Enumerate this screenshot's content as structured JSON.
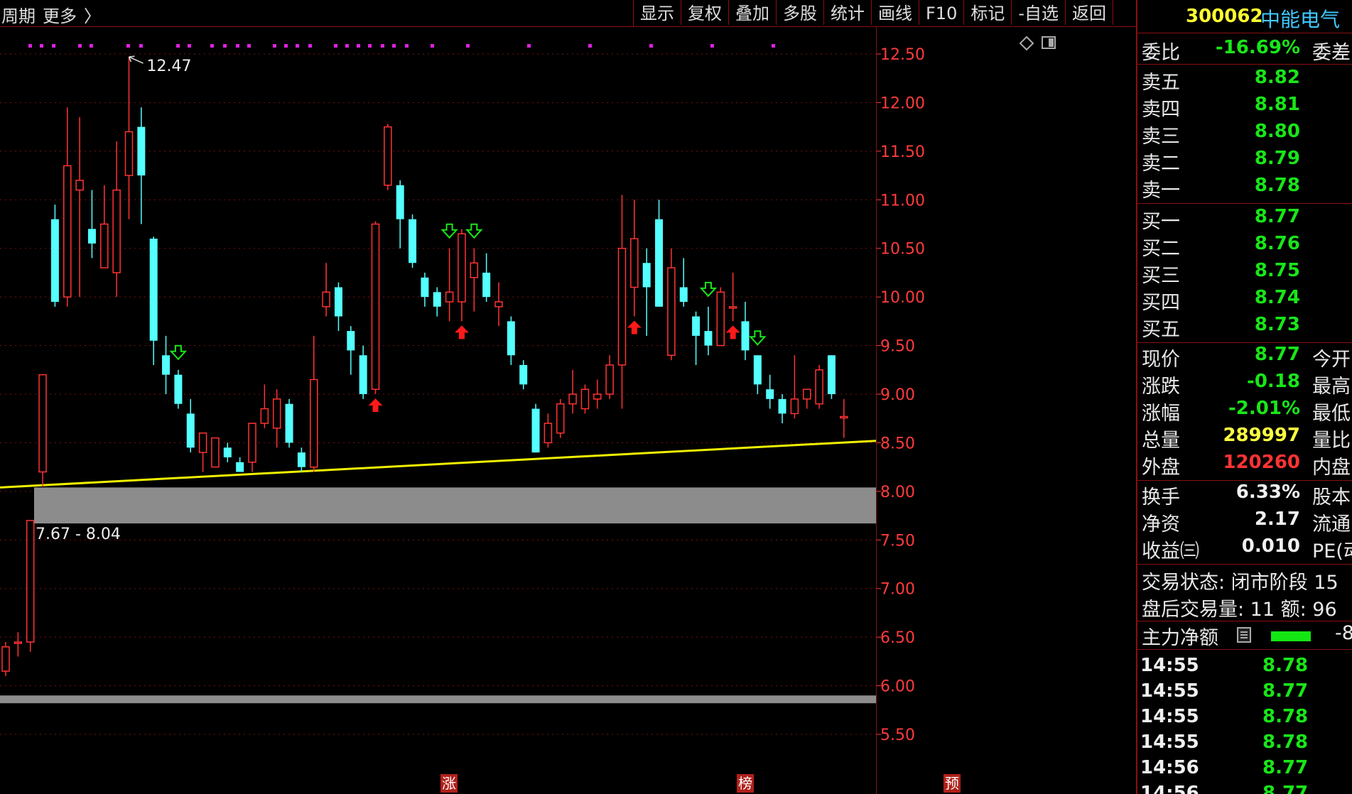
{
  "toolbar": {
    "period_label": "周期",
    "more_label": "更多",
    "more_arrow": "〉",
    "menu": [
      "显示",
      "复权",
      "叠加",
      "多股",
      "统计",
      "画线",
      "F10",
      "标记",
      "-自选",
      "返回"
    ]
  },
  "stock": {
    "code": "300062",
    "name": "中能电气"
  },
  "quote": {
    "weibi_label": "委比",
    "weibi_value": "-16.69%",
    "weicha_label": "委差",
    "asks": [
      {
        "label": "卖五",
        "price": "8.82"
      },
      {
        "label": "卖四",
        "price": "8.81"
      },
      {
        "label": "卖三",
        "price": "8.80"
      },
      {
        "label": "卖二",
        "price": "8.79"
      },
      {
        "label": "卖一",
        "price": "8.78"
      }
    ],
    "bids": [
      {
        "label": "买一",
        "price": "8.77"
      },
      {
        "label": "买二",
        "price": "8.76"
      },
      {
        "label": "买三",
        "price": "8.75"
      },
      {
        "label": "买四",
        "price": "8.74"
      },
      {
        "label": "买五",
        "price": "8.73"
      }
    ],
    "stats": [
      {
        "label": "现价",
        "value": "8.77",
        "label2": "今开",
        "color": "green"
      },
      {
        "label": "涨跌",
        "value": "-0.18",
        "label2": "最高",
        "color": "green"
      },
      {
        "label": "涨幅",
        "value": "-2.01%",
        "label2": "最低",
        "color": "green"
      },
      {
        "label": "总量",
        "value": "289997",
        "label2": "量比",
        "color": "yellow"
      },
      {
        "label": "外盘",
        "value": "120260",
        "label2": "内盘",
        "color": "red"
      }
    ],
    "stats2": [
      {
        "label": "换手",
        "value": "6.33%",
        "label2": "股本"
      },
      {
        "label": "净资",
        "value": "2.17",
        "label2": "流通"
      },
      {
        "label": "收益㈢",
        "value": "0.010",
        "label2": "PE(动"
      }
    ],
    "trade_status": "交易状态: 闭市阶段 15",
    "after_hours": "盘后交易量: 11  额: 96",
    "net_label": "主力净额",
    "net_value": "-8",
    "ticks": [
      {
        "time": "14:55",
        "price": "8.78"
      },
      {
        "time": "14:55",
        "price": "8.77"
      },
      {
        "time": "14:55",
        "price": "8.78"
      },
      {
        "time": "14:55",
        "price": "8.78"
      },
      {
        "time": "14:56",
        "price": "8.77"
      },
      {
        "time": "14:56",
        "price": "8.77"
      }
    ]
  },
  "colors": {
    "up": "#ff3333",
    "down": "#54ffff",
    "grid": "#7a1010",
    "axis_text": "#ff3b3b",
    "trendline": "#f0f000",
    "zone": "#8c8c8c",
    "dot": "#e020e0"
  },
  "chart_data": {
    "type": "candlestick",
    "y_ticks": [
      "12.50",
      "12.00",
      "11.50",
      "11.00",
      "10.50",
      "10.00",
      "9.50",
      "9.00",
      "8.50",
      "8.00",
      "7.50",
      "7.00",
      "6.50",
      "6.00",
      "5.50"
    ],
    "ylim": [
      5.5,
      12.5
    ],
    "grid": true,
    "candles": [
      {
        "o": 6.15,
        "c": 6.4,
        "h": 6.45,
        "l": 6.1
      },
      {
        "o": 6.45,
        "c": 6.45,
        "h": 6.55,
        "l": 6.3
      },
      {
        "o": 6.45,
        "c": 7.7,
        "h": 7.7,
        "l": 6.35
      },
      {
        "o": 8.2,
        "c": 9.2,
        "h": 9.2,
        "l": 8.05
      },
      {
        "o": 10.8,
        "c": 9.95,
        "h": 10.95,
        "l": 9.9
      },
      {
        "o": 10.0,
        "c": 11.35,
        "h": 11.95,
        "l": 9.9
      },
      {
        "o": 11.1,
        "c": 11.2,
        "h": 11.85,
        "l": 10.0
      },
      {
        "o": 10.7,
        "c": 10.55,
        "h": 11.1,
        "l": 10.4
      },
      {
        "o": 10.3,
        "c": 10.75,
        "h": 11.15,
        "l": 10.5
      },
      {
        "o": 10.25,
        "c": 11.1,
        "h": 11.6,
        "l": 10.0
      },
      {
        "o": 11.25,
        "c": 11.7,
        "h": 12.47,
        "l": 10.8
      },
      {
        "o": 11.75,
        "c": 11.25,
        "h": 11.95,
        "l": 10.75
      },
      {
        "o": 10.6,
        "c": 9.55,
        "h": 10.62,
        "l": 9.3
      },
      {
        "o": 9.4,
        "c": 9.2,
        "h": 9.6,
        "l": 9.0
      },
      {
        "o": 9.2,
        "c": 8.9,
        "h": 9.25,
        "l": 8.85
      },
      {
        "o": 8.8,
        "c": 8.45,
        "h": 8.95,
        "l": 8.4
      },
      {
        "o": 8.4,
        "c": 8.6,
        "h": 8.6,
        "l": 8.2
      },
      {
        "o": 8.25,
        "c": 8.55,
        "h": 8.55,
        "l": 8.25
      },
      {
        "o": 8.45,
        "c": 8.35,
        "h": 8.5,
        "l": 8.3
      },
      {
        "o": 8.3,
        "c": 8.2,
        "h": 8.35,
        "l": 8.2
      },
      {
        "o": 8.3,
        "c": 8.7,
        "h": 8.7,
        "l": 8.2
      },
      {
        "o": 8.7,
        "c": 8.85,
        "h": 9.1,
        "l": 8.65
      },
      {
        "o": 8.65,
        "c": 8.95,
        "h": 9.05,
        "l": 8.45
      },
      {
        "o": 8.9,
        "c": 8.5,
        "h": 8.95,
        "l": 8.45
      },
      {
        "o": 8.4,
        "c": 8.25,
        "h": 8.45,
        "l": 8.2
      },
      {
        "o": 8.25,
        "c": 9.15,
        "h": 9.6,
        "l": 8.2
      },
      {
        "o": 9.9,
        "c": 10.05,
        "h": 10.35,
        "l": 9.8
      },
      {
        "o": 10.1,
        "c": 9.8,
        "h": 10.15,
        "l": 9.65
      },
      {
        "o": 9.65,
        "c": 9.45,
        "h": 9.7,
        "l": 9.2
      },
      {
        "o": 9.4,
        "c": 9.0,
        "h": 9.5,
        "l": 8.95
      },
      {
        "o": 9.05,
        "c": 10.75,
        "h": 10.78,
        "l": 9.0
      },
      {
        "o": 11.15,
        "c": 11.75,
        "h": 11.78,
        "l": 11.1
      },
      {
        "o": 11.15,
        "c": 10.8,
        "h": 11.2,
        "l": 10.5
      },
      {
        "o": 10.8,
        "c": 10.35,
        "h": 10.85,
        "l": 10.3
      },
      {
        "o": 10.2,
        "c": 10.0,
        "h": 10.25,
        "l": 9.9
      },
      {
        "o": 10.05,
        "c": 9.9,
        "h": 10.1,
        "l": 9.8
      },
      {
        "o": 9.95,
        "c": 10.05,
        "h": 10.5,
        "l": 9.75
      },
      {
        "o": 9.95,
        "c": 10.65,
        "h": 10.7,
        "l": 9.75
      },
      {
        "o": 10.2,
        "c": 10.35,
        "h": 10.5,
        "l": 9.85
      },
      {
        "o": 10.25,
        "c": 10.0,
        "h": 10.45,
        "l": 9.95
      },
      {
        "o": 9.9,
        "c": 9.95,
        "h": 10.15,
        "l": 9.7
      },
      {
        "o": 9.75,
        "c": 9.4,
        "h": 9.8,
        "l": 9.3
      },
      {
        "o": 9.3,
        "c": 9.1,
        "h": 9.35,
        "l": 9.05
      },
      {
        "o": 8.85,
        "c": 8.4,
        "h": 8.9,
        "l": 8.4
      },
      {
        "o": 8.5,
        "c": 8.7,
        "h": 8.8,
        "l": 8.45
      },
      {
        "o": 8.6,
        "c": 8.9,
        "h": 8.95,
        "l": 8.55
      },
      {
        "o": 8.9,
        "c": 9.0,
        "h": 9.25,
        "l": 8.8
      },
      {
        "o": 8.85,
        "c": 9.05,
        "h": 9.1,
        "l": 8.8
      },
      {
        "o": 8.95,
        "c": 9.0,
        "h": 9.15,
        "l": 8.85
      },
      {
        "o": 9.0,
        "c": 9.3,
        "h": 9.4,
        "l": 8.95
      },
      {
        "o": 9.3,
        "c": 10.5,
        "h": 11.05,
        "l": 8.85
      },
      {
        "o": 10.1,
        "c": 10.6,
        "h": 11.0,
        "l": 9.8
      },
      {
        "o": 10.35,
        "c": 10.1,
        "h": 10.5,
        "l": 9.6
      },
      {
        "o": 10.8,
        "c": 9.9,
        "h": 11.0,
        "l": 9.9
      },
      {
        "o": 9.4,
        "c": 10.3,
        "h": 10.5,
        "l": 9.35
      },
      {
        "o": 10.1,
        "c": 9.95,
        "h": 10.4,
        "l": 9.9
      },
      {
        "o": 9.8,
        "c": 9.6,
        "h": 9.85,
        "l": 9.3
      },
      {
        "o": 9.65,
        "c": 9.5,
        "h": 9.9,
        "l": 9.4
      },
      {
        "o": 9.5,
        "c": 10.05,
        "h": 10.1,
        "l": 9.5
      },
      {
        "o": 9.9,
        "c": 9.9,
        "h": 10.25,
        "l": 9.75
      },
      {
        "o": 9.75,
        "c": 9.45,
        "h": 9.95,
        "l": 9.35
      },
      {
        "o": 9.4,
        "c": 9.1,
        "h": 9.4,
        "l": 9.0
      },
      {
        "o": 9.05,
        "c": 8.95,
        "h": 9.2,
        "l": 8.85
      },
      {
        "o": 8.95,
        "c": 8.8,
        "h": 9.0,
        "l": 8.7
      },
      {
        "o": 8.8,
        "c": 8.95,
        "h": 9.4,
        "l": 8.75
      },
      {
        "o": 8.95,
        "c": 9.05,
        "h": 9.05,
        "l": 8.85
      },
      {
        "o": 8.9,
        "c": 9.25,
        "h": 9.3,
        "l": 8.85
      },
      {
        "o": 9.4,
        "c": 9.0,
        "h": 9.4,
        "l": 8.95
      },
      {
        "o": 8.77,
        "c": 8.77,
        "h": 8.95,
        "l": 8.55
      }
    ],
    "x_start": 8,
    "x_step": 17.35,
    "high_label": "12.47",
    "high_index": 10,
    "zone_label": "7.67 - 8.04",
    "zone": [
      7.67,
      8.04
    ],
    "lower_band": [
      5.82,
      5.9
    ],
    "trendline": [
      [
        0,
        8.04
      ],
      [
        1233,
        8.52
      ]
    ],
    "down_arrows": [
      14,
      36,
      38,
      57,
      61
    ],
    "up_arrows": [
      30,
      37,
      51,
      59
    ],
    "dots_x": [
      40,
      56,
      73,
      110,
      126,
      178,
      196,
      248,
      264,
      296,
      314,
      332,
      348,
      384,
      400,
      416,
      434,
      470,
      486,
      502,
      518,
      536,
      552,
      570,
      606,
      656,
      742,
      828,
      914,
      1000,
      1086
    ],
    "markers": [
      {
        "text": "涨",
        "index": 30
      },
      {
        "text": "榜",
        "index": 50
      },
      {
        "text": "预",
        "index": 64
      }
    ]
  }
}
